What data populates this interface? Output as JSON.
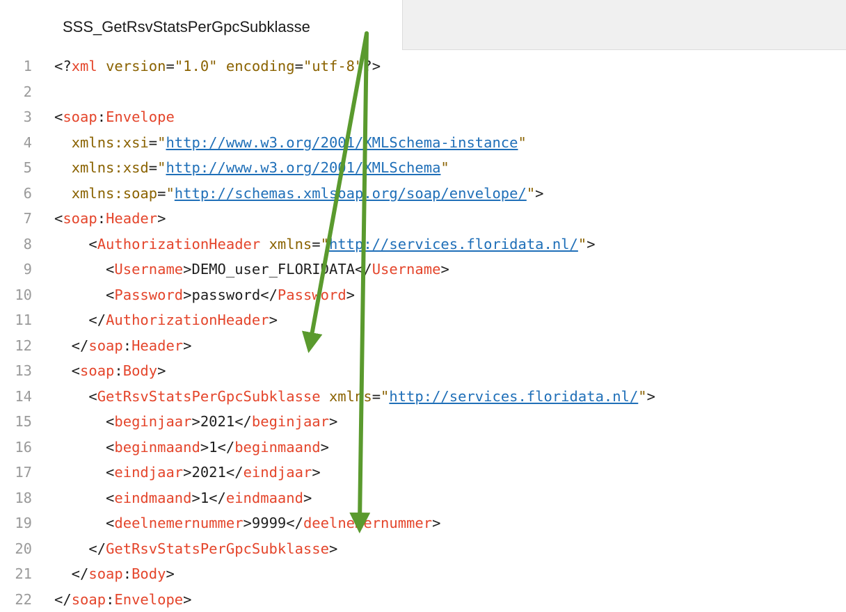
{
  "tab": {
    "title": "SSS_GetRsvStatsPerGpcSubklasse"
  },
  "lines": [
    {
      "n": "1",
      "segs": [
        [
          "p",
          "<?"
        ],
        [
          "tag",
          "xml"
        ],
        [
          "p",
          " "
        ],
        [
          "attr",
          "version"
        ],
        [
          "p",
          "="
        ],
        [
          "str",
          "\"1.0\""
        ],
        [
          "p",
          " "
        ],
        [
          "attr",
          "encoding"
        ],
        [
          "p",
          "="
        ],
        [
          "str",
          "\"utf-8\""
        ],
        [
          "p",
          "?>"
        ]
      ]
    },
    {
      "n": "2",
      "segs": []
    },
    {
      "n": "3",
      "segs": [
        [
          "p",
          "<"
        ],
        [
          "tag",
          "soap"
        ],
        [
          "p",
          ":"
        ],
        [
          "tag",
          "Envelope"
        ]
      ]
    },
    {
      "n": "4",
      "segs": [
        [
          "p",
          "  "
        ],
        [
          "attr",
          "xmlns:xsi"
        ],
        [
          "p",
          "="
        ],
        [
          "str",
          "\""
        ],
        [
          "url",
          "http://www.w3.org/2001/XMLSchema-instance"
        ],
        [
          "str",
          "\""
        ]
      ]
    },
    {
      "n": "5",
      "segs": [
        [
          "p",
          "  "
        ],
        [
          "attr",
          "xmlns:xsd"
        ],
        [
          "p",
          "="
        ],
        [
          "str",
          "\""
        ],
        [
          "url",
          "http://www.w3.org/2001/XMLSchema"
        ],
        [
          "str",
          "\""
        ]
      ]
    },
    {
      "n": "6",
      "segs": [
        [
          "p",
          "  "
        ],
        [
          "attr",
          "xmlns:soap"
        ],
        [
          "p",
          "="
        ],
        [
          "str",
          "\""
        ],
        [
          "url",
          "http://schemas.xmlsoap.org/soap/envelope/"
        ],
        [
          "str",
          "\""
        ],
        [
          "p",
          ">"
        ]
      ]
    },
    {
      "n": "7",
      "segs": [
        [
          "p",
          "<"
        ],
        [
          "tag",
          "soap"
        ],
        [
          "p",
          ":"
        ],
        [
          "tag",
          "Header"
        ],
        [
          "p",
          ">"
        ]
      ]
    },
    {
      "n": "8",
      "segs": [
        [
          "p",
          "    <"
        ],
        [
          "tag",
          "AuthorizationHeader"
        ],
        [
          "p",
          " "
        ],
        [
          "attr",
          "xmlns"
        ],
        [
          "p",
          "="
        ],
        [
          "str",
          "\""
        ],
        [
          "url",
          "http://services.floridata.nl/"
        ],
        [
          "str",
          "\""
        ],
        [
          "p",
          ">"
        ]
      ]
    },
    {
      "n": "9",
      "segs": [
        [
          "p",
          "      <"
        ],
        [
          "tag",
          "Username"
        ],
        [
          "p",
          ">DEMO_user_FLORIDATA</"
        ],
        [
          "tag",
          "Username"
        ],
        [
          "p",
          ">"
        ]
      ]
    },
    {
      "n": "10",
      "segs": [
        [
          "p",
          "      <"
        ],
        [
          "tag",
          "Password"
        ],
        [
          "p",
          ">password</"
        ],
        [
          "tag",
          "Password"
        ],
        [
          "p",
          ">"
        ]
      ]
    },
    {
      "n": "11",
      "segs": [
        [
          "p",
          "    </"
        ],
        [
          "tag",
          "AuthorizationHeader"
        ],
        [
          "p",
          ">"
        ]
      ]
    },
    {
      "n": "12",
      "segs": [
        [
          "p",
          "  </"
        ],
        [
          "tag",
          "soap"
        ],
        [
          "p",
          ":"
        ],
        [
          "tag",
          "Header"
        ],
        [
          "p",
          ">"
        ]
      ]
    },
    {
      "n": "13",
      "segs": [
        [
          "p",
          "  <"
        ],
        [
          "tag",
          "soap"
        ],
        [
          "p",
          ":"
        ],
        [
          "tag",
          "Body"
        ],
        [
          "p",
          ">"
        ]
      ]
    },
    {
      "n": "14",
      "segs": [
        [
          "p",
          "    <"
        ],
        [
          "tag",
          "GetRsvStatsPerGpcSubklasse"
        ],
        [
          "p",
          " "
        ],
        [
          "attr",
          "xmlns"
        ],
        [
          "p",
          "="
        ],
        [
          "str",
          "\""
        ],
        [
          "url",
          "http://services.floridata.nl/"
        ],
        [
          "str",
          "\""
        ],
        [
          "p",
          ">"
        ]
      ]
    },
    {
      "n": "15",
      "segs": [
        [
          "p",
          "      <"
        ],
        [
          "tag",
          "beginjaar"
        ],
        [
          "p",
          ">2021</"
        ],
        [
          "tag",
          "beginjaar"
        ],
        [
          "p",
          ">"
        ]
      ]
    },
    {
      "n": "16",
      "segs": [
        [
          "p",
          "      <"
        ],
        [
          "tag",
          "beginmaand"
        ],
        [
          "p",
          ">1</"
        ],
        [
          "tag",
          "beginmaand"
        ],
        [
          "p",
          ">"
        ]
      ]
    },
    {
      "n": "17",
      "segs": [
        [
          "p",
          "      <"
        ],
        [
          "tag",
          "eindjaar"
        ],
        [
          "p",
          ">2021</"
        ],
        [
          "tag",
          "eindjaar"
        ],
        [
          "p",
          ">"
        ]
      ]
    },
    {
      "n": "18",
      "segs": [
        [
          "p",
          "      <"
        ],
        [
          "tag",
          "eindmaand"
        ],
        [
          "p",
          ">1</"
        ],
        [
          "tag",
          "eindmaand"
        ],
        [
          "p",
          ">"
        ]
      ]
    },
    {
      "n": "19",
      "segs": [
        [
          "p",
          "      <"
        ],
        [
          "tag",
          "deelnemernummer"
        ],
        [
          "p",
          ">9999</"
        ],
        [
          "tag",
          "deelnemernummer"
        ],
        [
          "p",
          ">"
        ]
      ]
    },
    {
      "n": "20",
      "segs": [
        [
          "p",
          "    </"
        ],
        [
          "tag",
          "GetRsvStatsPerGpcSubklasse"
        ],
        [
          "p",
          ">"
        ]
      ]
    },
    {
      "n": "21",
      "segs": [
        [
          "p",
          "  </"
        ],
        [
          "tag",
          "soap"
        ],
        [
          "p",
          ":"
        ],
        [
          "tag",
          "Body"
        ],
        [
          "p",
          ">"
        ]
      ]
    },
    {
      "n": "22",
      "segs": [
        [
          "p",
          "</"
        ],
        [
          "tag",
          "soap"
        ],
        [
          "p",
          ":"
        ],
        [
          "tag",
          "Envelope"
        ],
        [
          "p",
          ">"
        ]
      ]
    }
  ],
  "colors": {
    "tag": "#e4452b",
    "attr": "#8a6200",
    "url": "#1f6fb8",
    "text": "#1e1e1e",
    "line_number": "#9a9a9a",
    "arrow": "#5a9a2e"
  }
}
